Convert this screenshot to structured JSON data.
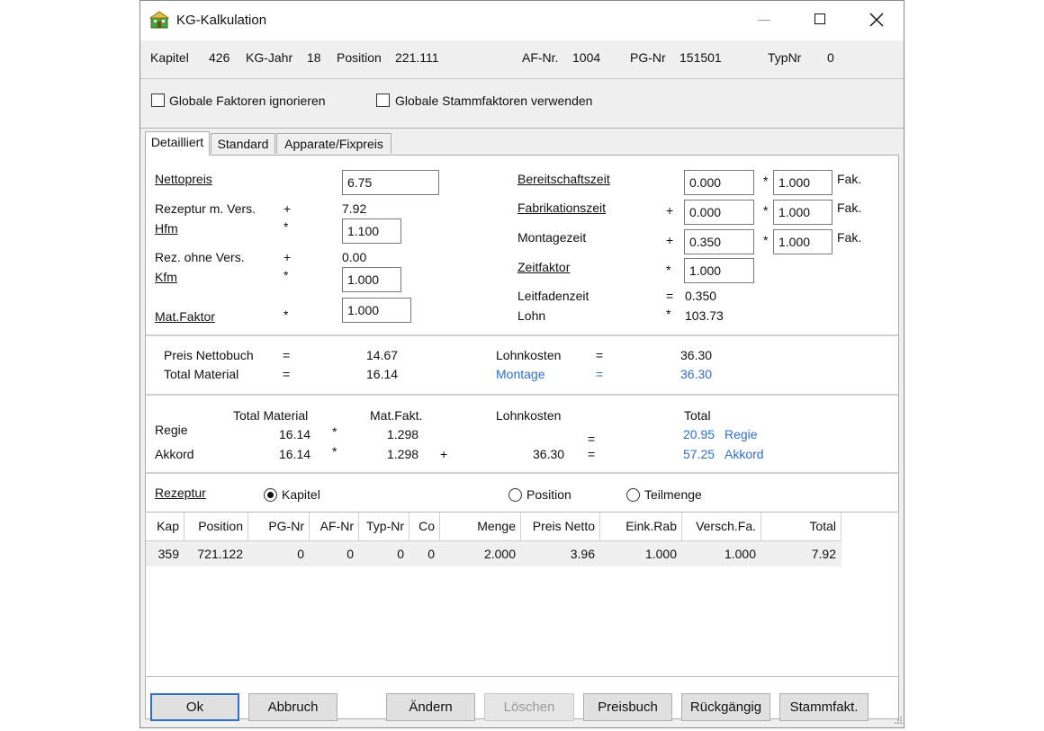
{
  "window": {
    "title": "KG-Kalkulation",
    "icon": "building-icon",
    "controls": {
      "minimize": "minimize-icon",
      "maximize": "maximize-icon",
      "close": "close-icon"
    }
  },
  "header": {
    "kapitel_label": "Kapitel",
    "kapitel_value": "426",
    "kgjahr_label": "KG-Jahr",
    "kgjahr_value": "18",
    "position_label": "Position",
    "position_value": "221.111",
    "afnr_label": "AF-Nr.",
    "afnr_value": "1004",
    "pgnr_label": "PG-Nr",
    "pgnr_value": "151501",
    "typnr_label": "TypNr",
    "typnr_value": "0"
  },
  "options": {
    "global_factors_label": "Globale Faktoren ignorieren",
    "global_factors_checked": false,
    "global_stamm_label": "Globale Stammfaktoren verwenden",
    "global_stamm_checked": false
  },
  "tabs": [
    {
      "label": "Detailliert",
      "active": true
    },
    {
      "label": "Standard",
      "active": false
    },
    {
      "label": "Apparate/Fixpreis",
      "active": false
    }
  ],
  "material": {
    "nettopreis_label": "Nettopreis",
    "nettopreis_value": "6.75",
    "rezeptur_label": "Rezeptur m. Vers.",
    "rezeptur_op": "+",
    "rezeptur_value": "7.92",
    "hfm_label": "Hfm",
    "hfm_op": "*",
    "hfm_value": "1.100",
    "rez_ohne_label": "Rez. ohne Vers.",
    "rez_ohne_op": "+",
    "rez_ohne_value": "0.00",
    "kfm_label": "Kfm",
    "kfm_op": "*",
    "kfm_value": "1.000",
    "matfaktor_label": "Mat.Faktor",
    "matfaktor_op": "*",
    "matfaktor_value": "1.000"
  },
  "zeit": {
    "bereitschaft_label": "Bereitschaftszeit",
    "bereitschaft_value": "0.000",
    "bereitschaft_fak": "1.000",
    "fabrikation_label": "Fabrikationszeit",
    "fabrikation_op": "+",
    "fabrikation_value": "0.000",
    "fabrikation_fak": "1.000",
    "montage_label": "Montagezeit",
    "montage_op": "+",
    "montage_value": "0.350",
    "montage_fak": "1.000",
    "fak_op": "*",
    "fak_label": "Fak.",
    "zeitfaktor_label": "Zeitfaktor",
    "zeitfaktor_op": "*",
    "zeitfaktor_value": "1.000",
    "leitfaden_label": "Leitfadenzeit",
    "leitfaden_op": "=",
    "leitfaden_value": "0.350",
    "lohn_label": "Lohn",
    "lohn_op": "*",
    "lohn_value": "103.73"
  },
  "summary": {
    "preis_nettobuch_label": "Preis Nettobuch",
    "preis_nettobuch_op": "=",
    "preis_nettobuch_value": "14.67",
    "total_material_label": "Total Material",
    "total_material_op": "=",
    "total_material_value": "16.14",
    "lohnkosten_label": "Lohnkosten",
    "lohnkosten_op": "=",
    "lohnkosten_value": "36.30",
    "montage_label": "Montage",
    "montage_op": "=",
    "montage_value": "36.30"
  },
  "totals": {
    "col_total_material": "Total Material",
    "col_matfakt": "Mat.Fakt.",
    "col_lohnkosten": "Lohnkosten",
    "col_total": "Total",
    "regie_label": "Regie",
    "regie_material": "16.14",
    "regie_op": "*",
    "regie_matfakt": "1.298",
    "regie_eq": "=",
    "regie_total": "20.95",
    "regie_total_label": "Regie",
    "akkord_label": "Akkord",
    "akkord_material": "16.14",
    "akkord_op": "*",
    "akkord_matfakt": "1.298",
    "akkord_plus": "+",
    "akkord_lohnkosten": "36.30",
    "akkord_eq": "=",
    "akkord_total": "57.25",
    "akkord_total_label": "Akkord"
  },
  "rezeptur": {
    "label": "Rezeptur",
    "radio_kapitel": "Kapitel",
    "radio_position": "Position",
    "radio_teilmenge": "Teilmenge",
    "selected": "Kapitel"
  },
  "grid": {
    "columns": [
      "Kap",
      "Position",
      "PG-Nr",
      "AF-Nr",
      "Typ-Nr",
      "Co",
      "Menge",
      "Preis Netto",
      "Eink.Rab",
      "Versch.Fa.",
      "Total"
    ],
    "rows": [
      [
        "359",
        "721.122",
        "0",
        "0",
        "0",
        "0",
        "2.000",
        "3.96",
        "1.000",
        "1.000",
        "7.92"
      ]
    ]
  },
  "buttons": {
    "ok": "Ok",
    "abbruch": "Abbruch",
    "aendern": "Ändern",
    "loeschen": "Löschen",
    "preisbuch": "Preisbuch",
    "rueckgaengig": "Rückgängig",
    "stammfakt": "Stammfakt."
  },
  "colors": {
    "accent": "#2f6fc9",
    "background": "#f0f0f0",
    "panel": "#ffffff"
  }
}
